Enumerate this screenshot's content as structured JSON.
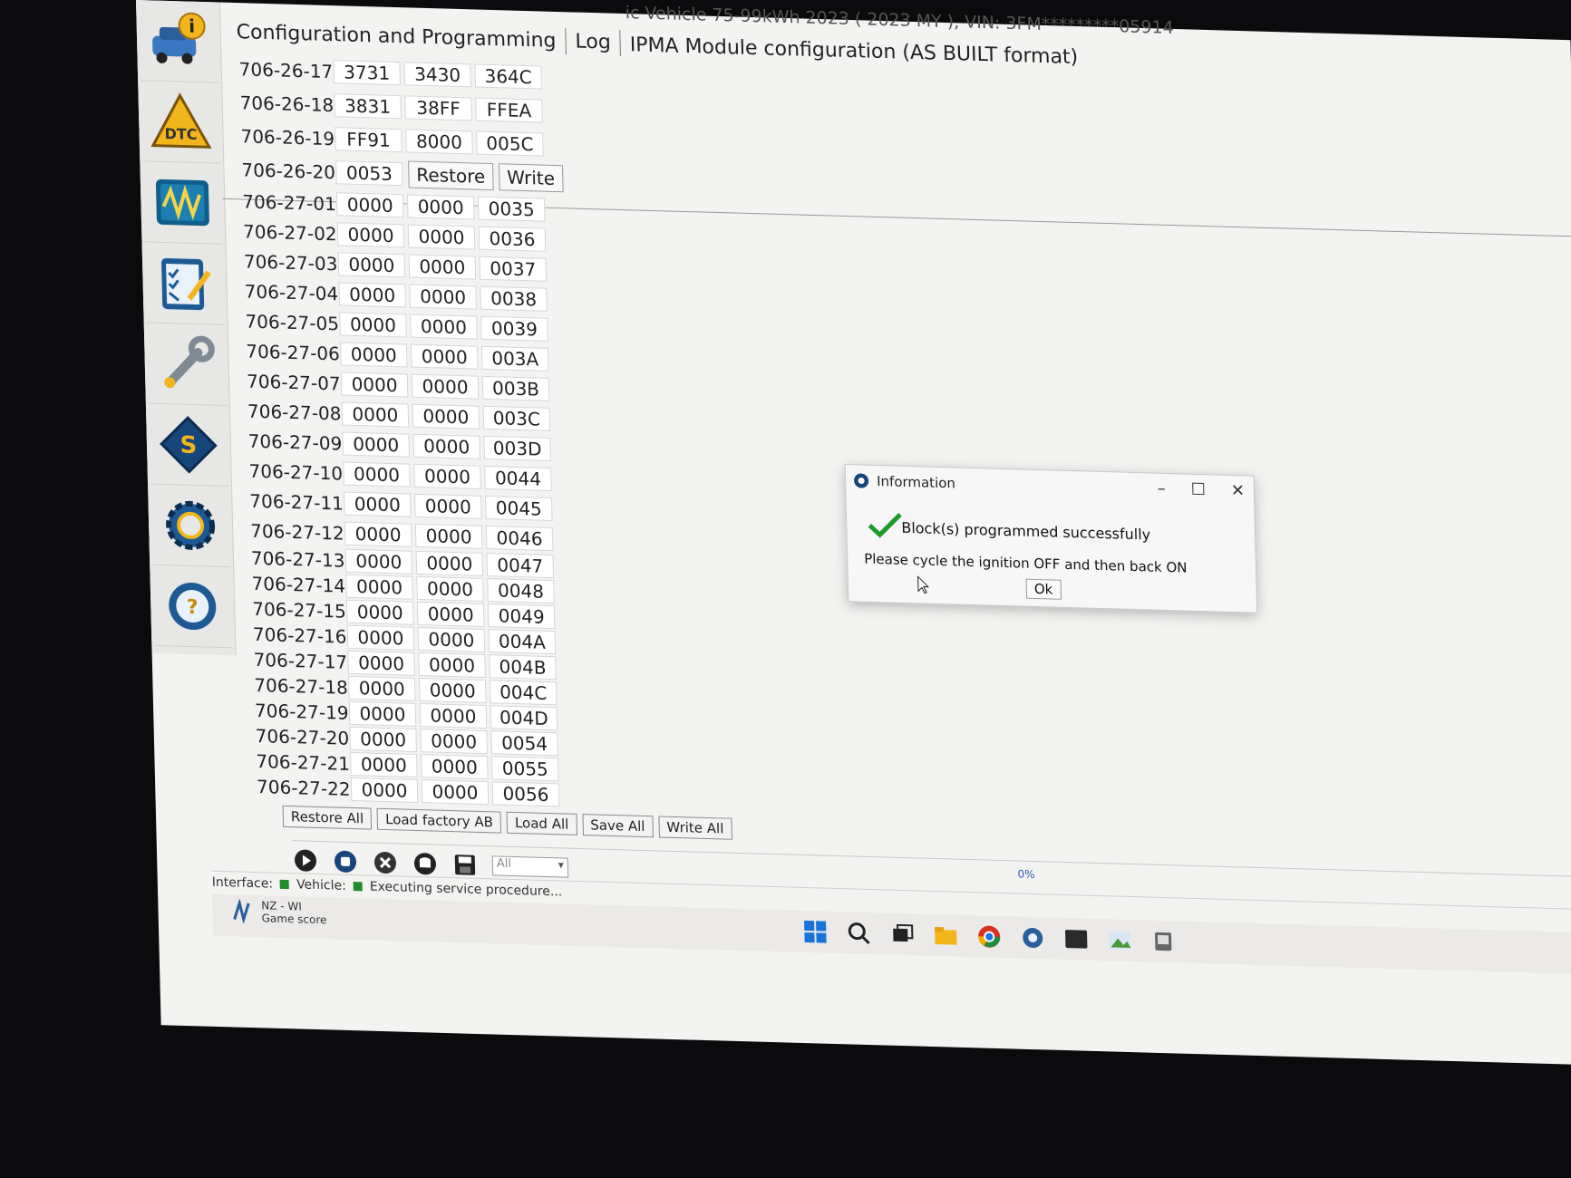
{
  "window": {
    "title": "ic Vehicle 75-99kWh 2023 ( 2023 MY ), VIN: 3FM*********05914",
    "tabs": [
      "Configuration and Programming",
      "Log"
    ],
    "editor_title": "IPMA Module configuration (AS BUILT format)"
  },
  "sidebar": {
    "items": [
      {
        "icon": "vehicle-info-icon"
      },
      {
        "icon": "dtc-warning-icon"
      },
      {
        "icon": "oscilloscope-icon"
      },
      {
        "icon": "checklist-icon"
      },
      {
        "icon": "wrench-icon"
      },
      {
        "icon": "module-programming-icon"
      },
      {
        "icon": "gear-icon"
      },
      {
        "icon": "help-steering-icon"
      }
    ]
  },
  "grid": {
    "rows": [
      {
        "addr": "706-26-17",
        "cells": [
          "3731",
          "3430",
          "364C"
        ]
      },
      {
        "addr": "706-26-18",
        "cells": [
          "3831",
          "38FF",
          "FFEA"
        ]
      },
      {
        "addr": "706-26-19",
        "cells": [
          "FF91",
          "8000",
          "005C"
        ]
      },
      {
        "addr": "706-26-20",
        "cells": [
          "0053"
        ],
        "buttons": [
          "Restore",
          "Write"
        ]
      },
      {
        "addr": "706-27-01",
        "cells": [
          "0000",
          "0000",
          "0035"
        ]
      },
      {
        "addr": "706-27-02",
        "cells": [
          "0000",
          "0000",
          "0036"
        ]
      },
      {
        "addr": "706-27-03",
        "cells": [
          "0000",
          "0000",
          "0037"
        ]
      },
      {
        "addr": "706-27-04",
        "cells": [
          "0000",
          "0000",
          "0038"
        ]
      },
      {
        "addr": "706-27-05",
        "cells": [
          "0000",
          "0000",
          "0039"
        ]
      },
      {
        "addr": "706-27-06",
        "cells": [
          "0000",
          "0000",
          "003A"
        ]
      },
      {
        "addr": "706-27-07",
        "cells": [
          "0000",
          "0000",
          "003B"
        ]
      },
      {
        "addr": "706-27-08",
        "cells": [
          "0000",
          "0000",
          "003C"
        ]
      },
      {
        "addr": "706-27-09",
        "cells": [
          "0000",
          "0000",
          "003D"
        ]
      },
      {
        "addr": "706-27-10",
        "cells": [
          "0000",
          "0000",
          "0044"
        ]
      },
      {
        "addr": "706-27-11",
        "cells": [
          "0000",
          "0000",
          "0045"
        ]
      },
      {
        "addr": "706-27-12",
        "cells": [
          "0000",
          "0000",
          "0046"
        ]
      },
      {
        "addr": "706-27-13",
        "cells": [
          "0000",
          "0000",
          "0047"
        ]
      },
      {
        "addr": "706-27-14",
        "cells": [
          "0000",
          "0000",
          "0048"
        ]
      },
      {
        "addr": "706-27-15",
        "cells": [
          "0000",
          "0000",
          "0049"
        ]
      },
      {
        "addr": "706-27-16",
        "cells": [
          "0000",
          "0000",
          "004A"
        ]
      },
      {
        "addr": "706-27-17",
        "cells": [
          "0000",
          "0000",
          "004B"
        ]
      },
      {
        "addr": "706-27-18",
        "cells": [
          "0000",
          "0000",
          "004C"
        ]
      },
      {
        "addr": "706-27-19",
        "cells": [
          "0000",
          "0000",
          "004D"
        ]
      },
      {
        "addr": "706-27-20",
        "cells": [
          "0000",
          "0000",
          "0054"
        ]
      },
      {
        "addr": "706-27-21",
        "cells": [
          "0000",
          "0000",
          "0055"
        ]
      },
      {
        "addr": "706-27-22",
        "cells": [
          "0000",
          "0000",
          "0056"
        ]
      }
    ]
  },
  "bottom_buttons": [
    "Restore All",
    "Load factory AB",
    "Load All",
    "Save All",
    "Write All"
  ],
  "toolbar": {
    "icons": [
      "play-icon",
      "stop-icon",
      "clear-icon",
      "database-icon",
      "save-disk-icon"
    ],
    "filter_value": "All",
    "progress": "0%"
  },
  "status": {
    "interface_label": "Interface:",
    "vehicle_label": "Vehicle:",
    "message": "Executing service procedure...",
    "led_color": "#1d8c2a"
  },
  "taskbar": {
    "weather_line1": "NZ - WI",
    "weather_line2": "Game score",
    "icons": [
      "windows-start-icon",
      "search-icon",
      "task-view-icon",
      "file-explorer-icon",
      "chrome-icon",
      "app-icon",
      "terminal-icon",
      "photo-app-icon",
      "device-icon"
    ]
  },
  "dialog": {
    "title": "Information",
    "message1": "Block(s) programmed successfully",
    "message2": "Please cycle the ignition OFF and then back ON",
    "ok_label": "Ok",
    "check_color": "#1f9a2a"
  }
}
